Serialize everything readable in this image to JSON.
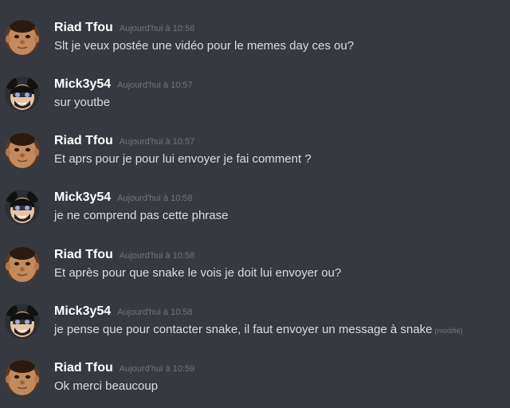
{
  "messages": [
    {
      "author": "Riad Tfou",
      "timestamp": "Aujourd'hui à 10:56",
      "text": "Slt je veux postée une vidéo pour le memes day ces ou?",
      "edited": "",
      "avatar": "riad-avatar"
    },
    {
      "author": "Mick3y54",
      "timestamp": "Aujourd'hui à 10:57",
      "text": "sur youtbe",
      "edited": "",
      "avatar": "mickey-avatar"
    },
    {
      "author": "Riad Tfou",
      "timestamp": "Aujourd'hui à 10:57",
      "text": "Et aprs pour je pour lui envoyer je fai comment ?",
      "edited": "",
      "avatar": "riad-avatar"
    },
    {
      "author": "Mick3y54",
      "timestamp": "Aujourd'hui à 10:58",
      "text": "je ne comprend pas cette phrase",
      "edited": "",
      "avatar": "mickey-avatar"
    },
    {
      "author": "Riad Tfou",
      "timestamp": "Aujourd'hui à 10:58",
      "text": "Et après pour que snake le vois je doit lui envoyer ou?",
      "edited": "",
      "avatar": "riad-avatar"
    },
    {
      "author": "Mick3y54",
      "timestamp": "Aujourd'hui à 10:58",
      "text": "je pense que pour contacter snake, il faut envoyer un message à snake",
      "edited": "(modifié)",
      "avatar": "mickey-avatar"
    },
    {
      "author": "Riad Tfou",
      "timestamp": "Aujourd'hui à 10:59",
      "text": "Ok merci beaucoup",
      "edited": "",
      "avatar": "riad-avatar"
    }
  ],
  "colors": {
    "background": "#36393f",
    "username": "#ffffff",
    "timestamp": "#72767d",
    "text": "#dcddde"
  }
}
